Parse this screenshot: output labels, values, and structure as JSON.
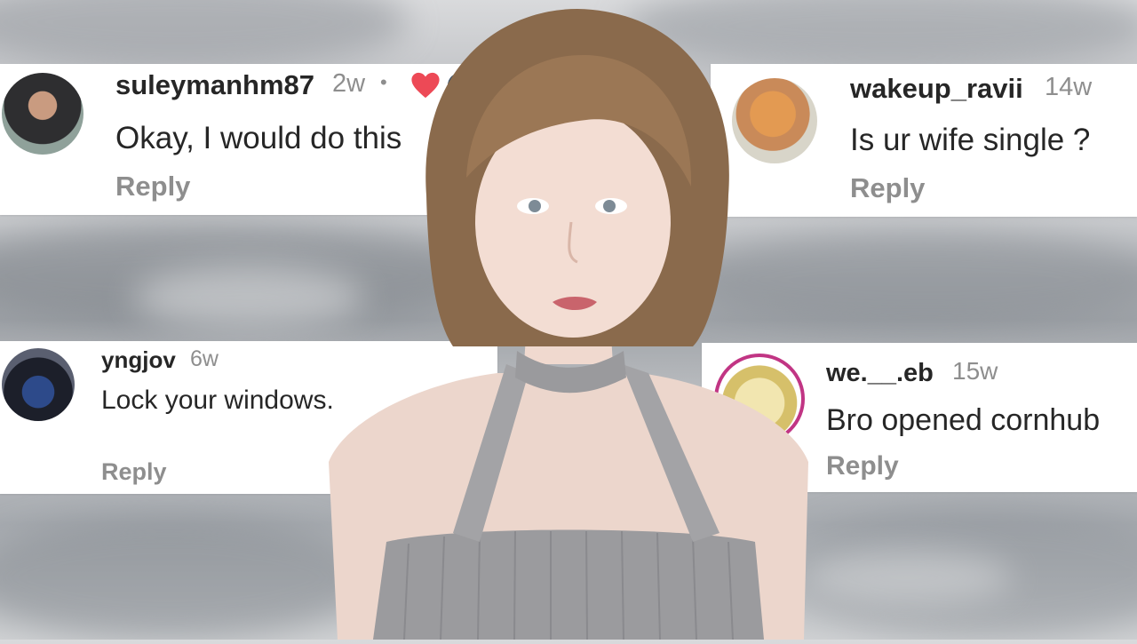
{
  "comments": [
    {
      "username": "suleymanhm87",
      "age": "2w",
      "text": "Okay, I would do this",
      "reply": "Reply"
    },
    {
      "username": "wakeup_ravii",
      "age": "14w",
      "text": "Is ur wife single ?",
      "reply": "Reply"
    },
    {
      "username": "yngjov",
      "age": "6w",
      "text": "Lock your windows.",
      "reply": "Reply"
    },
    {
      "username": "we.__.eb",
      "age": "15w",
      "text": "Bro opened cornhub",
      "reply": "Reply"
    }
  ],
  "separator": "•",
  "colors": {
    "like_heart": "#ed4956",
    "username": "#262626",
    "meta": "#8e8e8e"
  },
  "icons": [
    "heart-icon"
  ]
}
